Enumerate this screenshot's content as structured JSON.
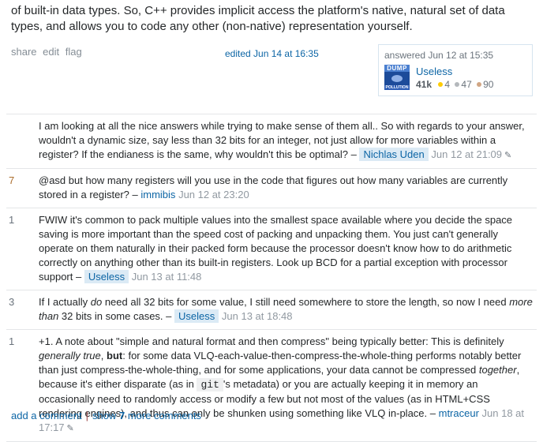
{
  "answer": {
    "text_line1": "of built-in data types. So, C++ provides implicit access the platform's native, natural set of data",
    "text_line2": "types, and allows you to code any other (non-native) representation yourself."
  },
  "post_menu": {
    "share": "share",
    "edit": "edit",
    "flag": "flag"
  },
  "edited": "edited Jun 14 at 16:35",
  "user_card": {
    "action_time": "answered Jun 12 at 15:35",
    "avatar_text_top": "DUMP",
    "avatar_text_bottom": "POLLUTION",
    "name": "Useless",
    "reputation": "41k",
    "badges": [
      {
        "type": "gold",
        "count": "4",
        "color": "#ffcc01"
      },
      {
        "type": "silver",
        "count": "47",
        "color": "#b4b8bc"
      },
      {
        "type": "bronze",
        "count": "90",
        "color": "#d1a684"
      }
    ]
  },
  "comments": [
    {
      "score": "",
      "parts": {
        "text": "I am looking at all the nice answers while trying to make sense of them all.. So with regards to your answer, wouldn't a dynamic size, say less than 32 bits for an integer, not just allow for more variables within a register? If the endianess is the same, why wouldn't this be optimal?",
        "sep": " – ",
        "user": "Nichlas Uden",
        "date": "Jun 12 at 21:09"
      },
      "edited_icon": "pencil-icon"
    },
    {
      "score": "7",
      "parts": {
        "text": "@asd but how many registers will you use in the code that figures out how many variables are currently stored in a register?",
        "sep": " – ",
        "user": "immibis",
        "date": "Jun 12 at 23:20"
      }
    },
    {
      "score": "1",
      "parts": {
        "text": "FWIW it's common to pack multiple values into the smallest space available where you decide the space saving is more important than the speed cost of packing and unpacking them. You just can't generally operate on them naturally in their packed form because the processor doesn't know how to do arithmetic correctly on anything other than its built-in registers. Look up BCD for a partial exception with processor support",
        "sep": " – ",
        "user": "Useless",
        "date": "Jun 13 at 11:48"
      }
    },
    {
      "score": "3",
      "parts": {
        "pre": "If I actually ",
        "em1": "do",
        "mid": " need all 32 bits for some value, I still need somewhere to store the length, so now I need ",
        "em2": "more than",
        "post": " 32 bits in some cases.",
        "sep": " – ",
        "user": "Useless",
        "date": "Jun 13 at 18:48"
      }
    },
    {
      "score": "1",
      "parts": {
        "t1": "+1. A note about \"simple and natural format and then compress\" being typically better: This is definitely ",
        "em1": "generally true",
        "t2": ", ",
        "strong": "but",
        "t3": ": for some data VLQ-each-value-then-compress-the-whole-thing performs notably better than just compress-the-whole-thing, and for some applications, your data cannot be compressed ",
        "em2": "together",
        "t4": ", because it's either disparate (as in ",
        "code": "git",
        "t5": "'s metadata) or you are actually keeping it in memory an occasionally need to randomly access or modify a few but not most of the values (as in HTML+CSS rendering engines), and thus can only be shunken using something like VLQ in-place.",
        "sep": " – ",
        "user": "mtraceur",
        "date": "Jun 18 at 17:17"
      },
      "edited_icon": "pencil-icon"
    }
  ],
  "comment_links": {
    "add": "add a comment",
    "separator": "|",
    "show_pre": "show ",
    "show_count": "7",
    "show_post": " more comments"
  }
}
